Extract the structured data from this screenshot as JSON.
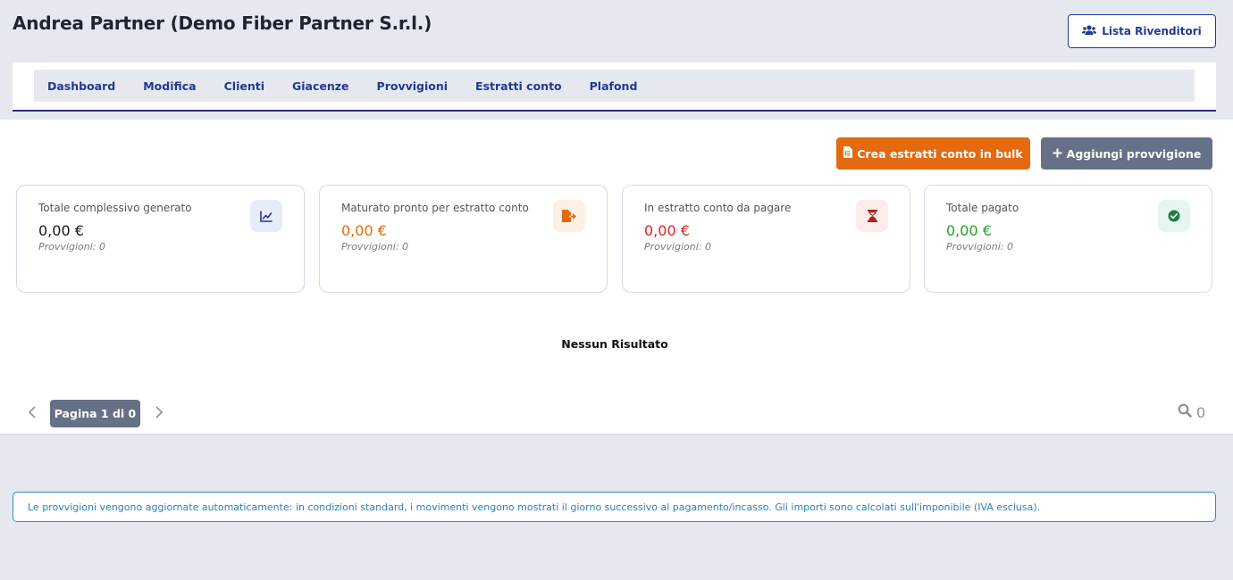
{
  "header": {
    "title": "Andrea Partner (Demo Fiber Partner S.r.l.)",
    "reseller_button": "Lista Rivenditori",
    "reseller_icon": "users-icon"
  },
  "nav": {
    "items": [
      "Dashboard",
      "Modifica",
      "Clienti",
      "Giacenze",
      "Provvigioni",
      "Estratti conto",
      "Plafond"
    ]
  },
  "actions": {
    "bulk_label": "Crea estratti conto in bulk",
    "bulk_icon": "file-invoice-icon",
    "add_label": "Aggiungi provvigione",
    "add_icon": "plus-icon"
  },
  "cards": [
    {
      "label": "Totale complessivo generato",
      "value": "0,00 €",
      "sub": "Provvigioni: 0",
      "icon": "chart-line-icon",
      "value_color": "#1a1a1a",
      "icon_color": "#1f3a93",
      "icon_bg": "#e8ebf8"
    },
    {
      "label": "Maturato pronto per estratto conto",
      "value": "0,00 €",
      "sub": "Provvigioni: 0",
      "icon": "file-export-icon",
      "value_color": "#e5690f",
      "icon_color": "#e5690f",
      "icon_bg": "#fdf0e5"
    },
    {
      "label": "In estratto conto da pagare",
      "value": "0,00 €",
      "sub": "Provvigioni: 0",
      "icon": "hourglass-icon",
      "value_color": "#d7261e",
      "icon_color": "#b02020",
      "icon_bg": "#fcebec"
    },
    {
      "label": "Totale pagato",
      "value": "0,00 €",
      "sub": "Provvigioni: 0",
      "icon": "check-circle-icon",
      "value_color": "#2a9d23",
      "icon_color": "#1f7a4a",
      "icon_bg": "#e6f5ee"
    }
  ],
  "results": {
    "empty_message": "Nessun Risultato"
  },
  "pagination": {
    "label": "Pagina 1 di 0",
    "search_count": "0"
  },
  "info": {
    "text": "Le provvigioni vengono aggiornate automaticamente: in condizioni standard, i movimenti vengono mostrati il giorno successivo al pagamento/incasso. Gli importi sono calcolati sull'imponibile (IVA esclusa)."
  },
  "colors": {
    "accent": "#1f3a93",
    "orange": "#e5690f",
    "slate": "#667086",
    "info": "#2b8fd6"
  }
}
